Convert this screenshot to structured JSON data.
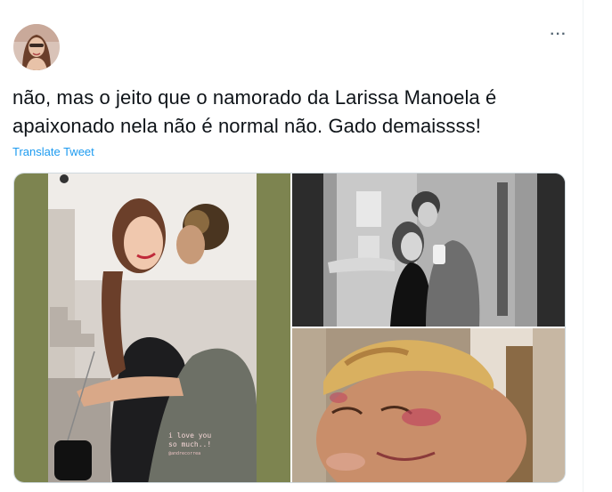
{
  "tweet": {
    "text": "não, mas o jeito que o namorado da Larissa Manoela é apaixonado nela não é normal não. Gado demaissss!",
    "translate_label": "Translate Tweet",
    "more_label": "···"
  },
  "media": {
    "sticker_line1": "i love you",
    "sticker_line2": "so much..!",
    "sticker_handle": "@andrecorrea"
  },
  "colors": {
    "link": "#1d9bf0",
    "text": "#0f1419",
    "border": "#cfd9de"
  }
}
